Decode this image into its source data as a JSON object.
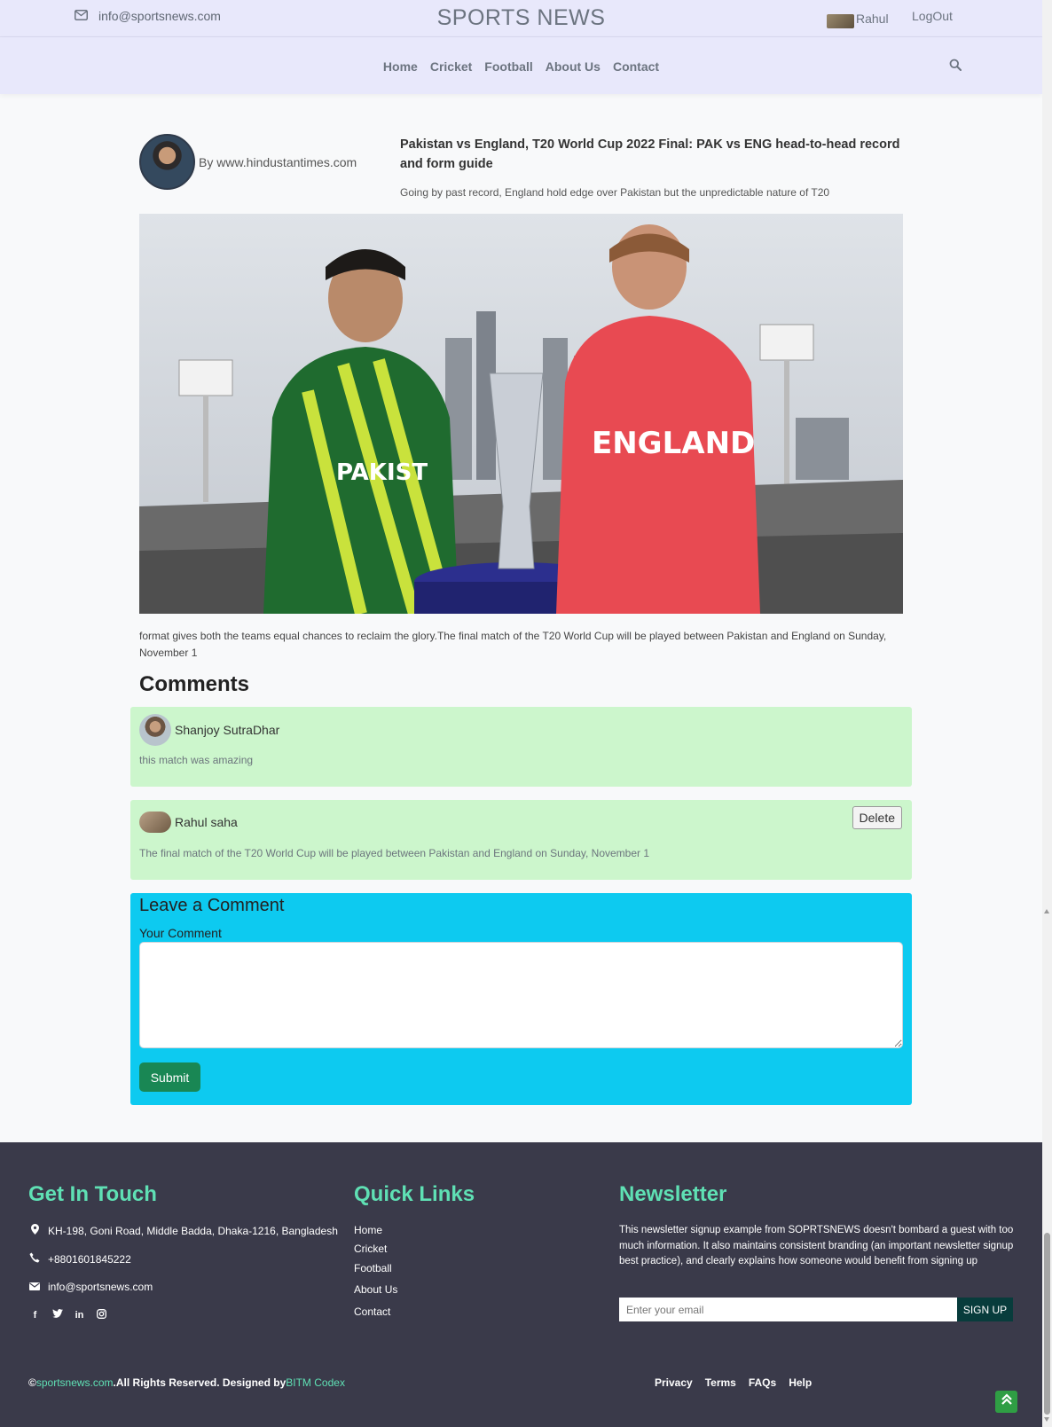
{
  "topbar": {
    "email": "info@sportsnews.com",
    "brand": "SPORTS NEWS",
    "user_name": "Rahul",
    "logout_label": "LogOut"
  },
  "nav": {
    "items": [
      "Home",
      "Cricket",
      "Football",
      "About Us",
      "Contact"
    ],
    "search_icon": "search-icon"
  },
  "article": {
    "author": "By www.hindustantimes.com",
    "title": "Pakistan vs England, T20 World Cup 2022 Final: PAK vs ENG head-to-head record and form guide",
    "summary": "Going by past record, England hold edge over Pakistan but the unpredictable nature of T20",
    "image_labels": {
      "left_jersey": "PAKIST",
      "right_jersey": "ENGLAND"
    },
    "body": "format gives both the teams equal chances to reclaim the glory.The final match of the T20 World Cup will be played between Pakistan and England on Sunday, November 1"
  },
  "comments": {
    "title": "Comments",
    "items": [
      {
        "name": "Shanjoy SutraDhar",
        "text": "this match was amazing"
      },
      {
        "name": "Rahul saha",
        "text": "The final match of the T20 World Cup will be played between Pakistan and England on Sunday, November 1",
        "delete_label": "Delete"
      }
    ]
  },
  "leave_comment": {
    "title": "Leave a Comment",
    "label": "Your Comment",
    "value": "",
    "submit_label": "Submit"
  },
  "footer": {
    "contact": {
      "title": "Get In Touch",
      "address": "KH-198, Goni Road, Middle Badda, Dhaka-1216, Bangladesh",
      "phone": "+8801601845222",
      "email": "info@sportsnews.com",
      "socials": [
        "facebook-icon",
        "twitter-icon",
        "linkedin-icon",
        "instagram-icon"
      ]
    },
    "quick_links": {
      "title": "Quick Links",
      "items": [
        "Home",
        "Cricket",
        "Football",
        "About Us",
        "Contact"
      ]
    },
    "newsletter": {
      "title": "Newsletter",
      "text": "This newsletter signup example from SOPRTSNEWS doesn't bombard a guest with too much information. It also maintains consistent branding (an important newsletter signup best practice), and clearly explains how someone would benefit from signing up",
      "placeholder": "Enter your email",
      "button": "SIGN UP"
    },
    "copyright": {
      "prefix": "©",
      "site": "sportsnews.com",
      "middle": ".All Rights Reserved. Designed by",
      "designer": "BITM Codex"
    },
    "bottom_links": [
      "Privacy",
      "Terms",
      "FAQs",
      "Help"
    ]
  },
  "colors": {
    "header_bg": "#e8e8fb",
    "comment_bg": "#ccf6cc",
    "leave_bg": "#0dcaf0",
    "submit_bg": "#198754",
    "footer_bg": "#3a3a4a",
    "footer_accent": "#5fe0b4"
  }
}
